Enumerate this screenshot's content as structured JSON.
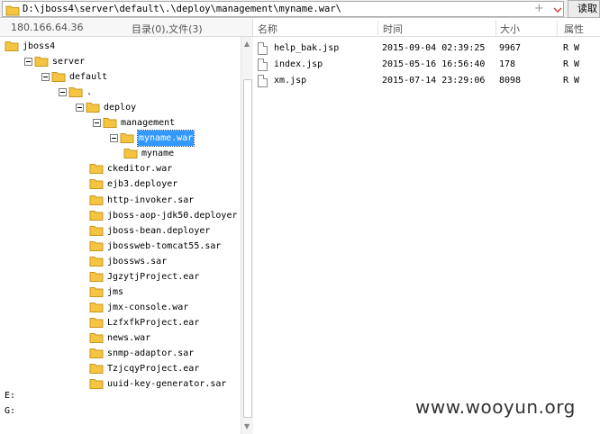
{
  "address": {
    "path": "D:\\jboss4\\server\\default\\.\\deploy\\management\\myname.war\\",
    "add_symbol": "+",
    "read_button": "读取"
  },
  "left_header": {
    "ip": "180.166.64.36",
    "dir_summary": "目录(0),文件(3)"
  },
  "tree": [
    {
      "label": "jboss4",
      "depth": 0,
      "toggle": false,
      "selected": false
    },
    {
      "label": "server",
      "depth": 1,
      "toggle": true,
      "selected": false
    },
    {
      "label": "default",
      "depth": 2,
      "toggle": true,
      "selected": false
    },
    {
      "label": ".",
      "depth": 3,
      "toggle": true,
      "selected": false
    },
    {
      "label": "deploy",
      "depth": 4,
      "toggle": true,
      "selected": false
    },
    {
      "label": "management",
      "depth": 5,
      "toggle": true,
      "selected": false
    },
    {
      "label": "myname.war",
      "depth": 6,
      "toggle": true,
      "selected": true
    },
    {
      "label": "myname",
      "depth": 7,
      "toggle": false,
      "selected": false
    },
    {
      "label": "ckeditor.war",
      "depth": 5,
      "toggle": false,
      "selected": false
    },
    {
      "label": "ejb3.deployer",
      "depth": 5,
      "toggle": false,
      "selected": false
    },
    {
      "label": "http-invoker.sar",
      "depth": 5,
      "toggle": false,
      "selected": false
    },
    {
      "label": "jboss-aop-jdk50.deployer",
      "depth": 5,
      "toggle": false,
      "selected": false
    },
    {
      "label": "jboss-bean.deployer",
      "depth": 5,
      "toggle": false,
      "selected": false
    },
    {
      "label": "jbossweb-tomcat55.sar",
      "depth": 5,
      "toggle": false,
      "selected": false
    },
    {
      "label": "jbossws.sar",
      "depth": 5,
      "toggle": false,
      "selected": false
    },
    {
      "label": "JgzytjProject.ear",
      "depth": 5,
      "toggle": false,
      "selected": false
    },
    {
      "label": "jms",
      "depth": 5,
      "toggle": false,
      "selected": false
    },
    {
      "label": "jmx-console.war",
      "depth": 5,
      "toggle": false,
      "selected": false
    },
    {
      "label": "LzfxfkProject.ear",
      "depth": 5,
      "toggle": false,
      "selected": false
    },
    {
      "label": "news.war",
      "depth": 5,
      "toggle": false,
      "selected": false
    },
    {
      "label": "snmp-adaptor.sar",
      "depth": 5,
      "toggle": false,
      "selected": false
    },
    {
      "label": "TzjcqyProject.ear",
      "depth": 5,
      "toggle": false,
      "selected": false
    },
    {
      "label": "uuid-key-generator.sar",
      "depth": 5,
      "toggle": false,
      "selected": false
    }
  ],
  "drives": [
    "E:",
    "G:"
  ],
  "file_list": {
    "headers": {
      "name": "名称",
      "time": "时间",
      "size": "大小",
      "attr": "属性"
    },
    "rows": [
      {
        "name": "help_bak.jsp",
        "time": "2015-09-04 02:39:25",
        "size": "9967",
        "attr": "R W"
      },
      {
        "name": "index.jsp",
        "time": "2015-05-16 16:56:40",
        "size": "178",
        "attr": "R W"
      },
      {
        "name": "xm.jsp",
        "time": "2015-07-14 23:29:06",
        "size": "8098",
        "attr": "R W"
      }
    ]
  },
  "watermark": "www.wooyun.org",
  "colors": {
    "folder": "#f5c542",
    "folder_edge": "#c8961e",
    "selection": "#3399ff"
  }
}
